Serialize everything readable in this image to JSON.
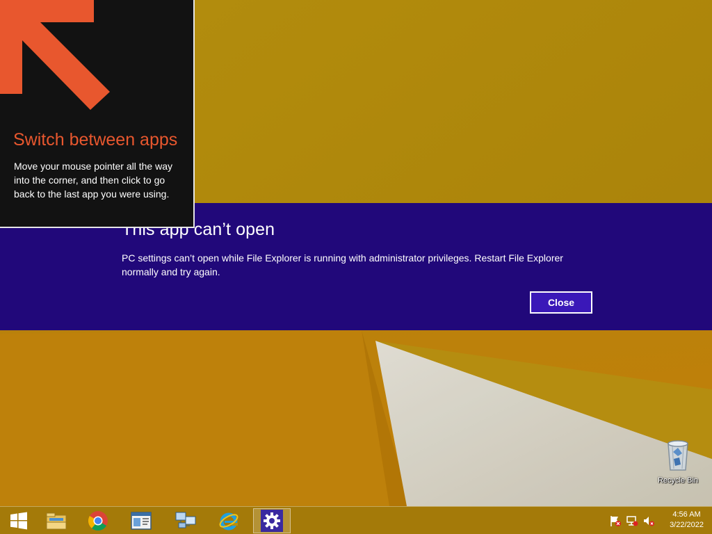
{
  "tip": {
    "title": "Switch between apps",
    "body": "Move your mouse pointer all the way into the corner, and then click to go back to the last app you were using."
  },
  "dialog": {
    "title": "This app can’t open",
    "message": "PC settings can’t open while File Explorer is running with administrator privileges. Restart File Explorer normally and try again.",
    "close_label": "Close"
  },
  "desktop": {
    "recycle_bin_label": "Recycle Bin"
  },
  "taskbar": {
    "items": [
      {
        "name": "start-button",
        "icon": "windows-logo-icon"
      },
      {
        "name": "file-explorer-button",
        "icon": "folder-icon"
      },
      {
        "name": "chrome-button",
        "icon": "chrome-icon"
      },
      {
        "name": "app-window-button",
        "icon": "window-icon"
      },
      {
        "name": "remote-desktop-button",
        "icon": "network-computer-icon"
      },
      {
        "name": "internet-explorer-button",
        "icon": "internet-explorer-icon"
      },
      {
        "name": "pc-settings-button",
        "icon": "gear-icon"
      }
    ],
    "tray": {
      "icons": [
        "action-center-flag-icon",
        "network-icon",
        "volume-muted-icon"
      ],
      "time": "4:56 AM",
      "date": "3/22/2022"
    }
  },
  "colors": {
    "dialog_bg": "#21087a",
    "tip_accent": "#e8572e",
    "wallpaper": "#b88e0c"
  }
}
